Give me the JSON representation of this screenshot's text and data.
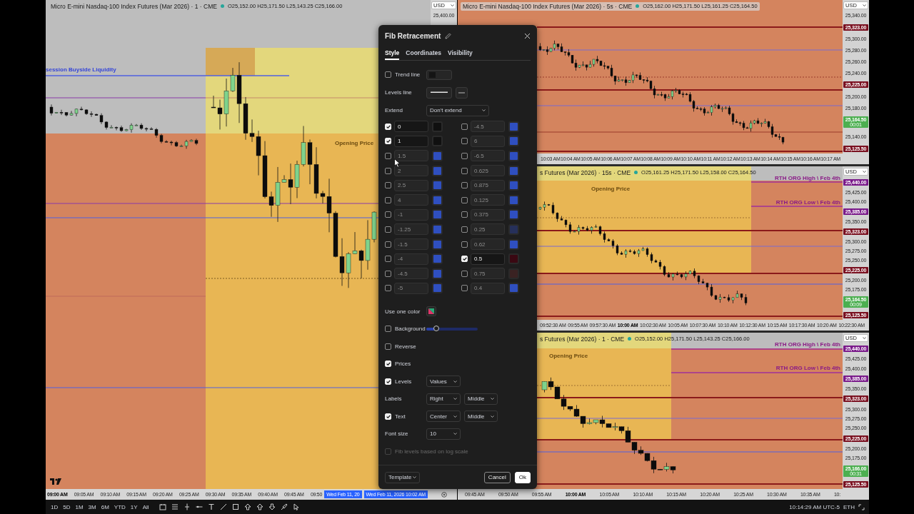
{
  "charts": [
    {
      "title": "Micro E-mini Nasdaq-100 Index Futures (Mar 2026) · 1 · CME",
      "ohlc": "O25,152.00 H25,171.50 L25,143.25 C25,166.00",
      "currency": "USD",
      "price_labels": [
        {
          "text": "25,400.00",
          "kind": "plain"
        }
      ],
      "line_labels": [
        {
          "text": "session Buyside Liquidity",
          "color": "#3545d8"
        },
        {
          "text": "Opening Price",
          "color": "#6a4a10"
        }
      ],
      "time_labels": [
        {
          "text": "09:00 AM",
          "major": true
        },
        {
          "text": "09:05 AM",
          "major": false
        },
        {
          "text": "09:10 AM",
          "major": false
        },
        {
          "text": "09:15 AM",
          "major": false
        },
        {
          "text": "09:20 AM",
          "major": false
        },
        {
          "text": "09:25 AM",
          "major": false
        },
        {
          "text": "09:30 AM",
          "major": false
        },
        {
          "text": "09:35 AM",
          "major": false
        },
        {
          "text": "09:40 AM",
          "major": false
        },
        {
          "text": "09:45 AM",
          "major": false
        },
        {
          "text": "09:50",
          "major": false
        }
      ],
      "date_tags": [
        "Wed Feb 11, 20",
        "Wed Feb 11, 2026 10:02 AM"
      ]
    },
    {
      "title": "Micro E-mini Nasdaq-100 Index Futures (Mar 2026) · 5s · CME",
      "ohlc": "O25,162.00 H25,171.50 L25,161.25 C25,164.50",
      "currency": "USD",
      "price_labels": [
        {
          "text": "25,340.00",
          "kind": "plain"
        },
        {
          "text": "25,323.00",
          "kind": "marker",
          "color": "#7a1020"
        },
        {
          "text": "25,300.00",
          "kind": "plain"
        },
        {
          "text": "25,280.00",
          "kind": "plain"
        },
        {
          "text": "25,260.00",
          "kind": "plain"
        },
        {
          "text": "25,240.00",
          "kind": "plain"
        },
        {
          "text": "25,225.00",
          "kind": "marker",
          "color": "#7a1020"
        },
        {
          "text": "25,200.00",
          "kind": "plain"
        },
        {
          "text": "25,180.00",
          "kind": "plain"
        },
        {
          "text": "25,164.50",
          "kind": "marker",
          "color": "#4caf50",
          "countdown": "00:01"
        },
        {
          "text": "25,140.00",
          "kind": "plain"
        },
        {
          "text": "25,125.50",
          "kind": "marker",
          "color": "#7a1020"
        }
      ],
      "time_labels": [
        {
          "text": "10:03 AM",
          "major": false
        },
        {
          "text": "10:04 AM",
          "major": false
        },
        {
          "text": "10:05 AM",
          "major": false
        },
        {
          "text": "10:06 AM",
          "major": false
        },
        {
          "text": "10:07 AM",
          "major": false
        },
        {
          "text": "10:08 AM",
          "major": false
        },
        {
          "text": "10:09 AM",
          "major": false
        },
        {
          "text": "10:10 AM",
          "major": false
        },
        {
          "text": "10:11 AM",
          "major": false
        },
        {
          "text": "10:12 AM",
          "major": false
        },
        {
          "text": "10:13 AM",
          "major": false
        },
        {
          "text": "10:14 AM",
          "major": false
        },
        {
          "text": "10:15 AM",
          "major": false
        },
        {
          "text": "10:16 AM",
          "major": false
        },
        {
          "text": "10:17 AM",
          "major": false
        }
      ]
    },
    {
      "title": "s Futures (Mar 2026) · 15s · CME",
      "ohlc": "O25,161.25 H25,171.50 L25,158.00 C25,164.50",
      "currency": "USD",
      "price_labels": [
        {
          "text": "25,440.00",
          "kind": "marker",
          "color": "#7a1a8a"
        },
        {
          "text": "25,425.00",
          "kind": "plain"
        },
        {
          "text": "25,400.00",
          "kind": "plain"
        },
        {
          "text": "25,385.00",
          "kind": "marker",
          "color": "#7a1a8a"
        },
        {
          "text": "25,350.00",
          "kind": "plain"
        },
        {
          "text": "25,323.00",
          "kind": "marker",
          "color": "#7a1020"
        },
        {
          "text": "25,300.00",
          "kind": "plain"
        },
        {
          "text": "25,275.00",
          "kind": "plain"
        },
        {
          "text": "25,250.00",
          "kind": "plain"
        },
        {
          "text": "25,225.00",
          "kind": "marker",
          "color": "#7a1020"
        },
        {
          "text": "25,200.00",
          "kind": "plain"
        },
        {
          "text": "25,175.00",
          "kind": "plain"
        },
        {
          "text": "25,164.50",
          "kind": "marker",
          "color": "#4caf50",
          "countdown": "00:09"
        },
        {
          "text": "25,125.50",
          "kind": "marker",
          "color": "#7a1020"
        }
      ],
      "line_labels": [
        {
          "text": "RTH ORG High \\ Feb 4th",
          "color": "#8a1a86"
        },
        {
          "text": "RTH ORG Low \\ Feb 4th",
          "color": "#8a1a86"
        },
        {
          "text": "Opening Price",
          "color": "#6a4a10"
        }
      ],
      "time_labels": [
        {
          "text": "09:52:30 AM",
          "major": false
        },
        {
          "text": "09:55 AM",
          "major": false
        },
        {
          "text": "09:57:30 AM",
          "major": false
        },
        {
          "text": "10:00 AM",
          "major": true
        },
        {
          "text": "10:02:30 AM",
          "major": false
        },
        {
          "text": "10:05 AM",
          "major": false
        },
        {
          "text": "10:07:30 AM",
          "major": false
        },
        {
          "text": "10:10 AM",
          "major": false
        },
        {
          "text": "10:12:30 AM",
          "major": false
        },
        {
          "text": "10:15 AM",
          "major": false
        },
        {
          "text": "10:17:30 AM",
          "major": false
        },
        {
          "text": "10:20 AM",
          "major": false
        },
        {
          "text": "10:22:30 AM",
          "major": false
        }
      ]
    },
    {
      "title": "s Futures (Mar 2026) · 1 · CME",
      "ohlc": "O25,152.00 H25,171.50 L25,143.25 C25,166.00",
      "currency": "USD",
      "price_labels": [
        {
          "text": "25,440.00",
          "kind": "marker",
          "color": "#7a1a8a"
        },
        {
          "text": "25,425.00",
          "kind": "plain"
        },
        {
          "text": "25,400.00",
          "kind": "plain"
        },
        {
          "text": "25,385.00",
          "kind": "marker",
          "color": "#7a1a8a"
        },
        {
          "text": "25,350.00",
          "kind": "plain"
        },
        {
          "text": "25,323.00",
          "kind": "marker",
          "color": "#7a1020"
        },
        {
          "text": "25,300.00",
          "kind": "plain"
        },
        {
          "text": "25,275.00",
          "kind": "plain"
        },
        {
          "text": "25,250.00",
          "kind": "plain"
        },
        {
          "text": "25,225.00",
          "kind": "marker",
          "color": "#7a1020"
        },
        {
          "text": "25,200.00",
          "kind": "plain"
        },
        {
          "text": "25,175.00",
          "kind": "plain"
        },
        {
          "text": "25,166.00",
          "kind": "marker",
          "color": "#4caf50",
          "countdown": "00:31"
        },
        {
          "text": "25,125.50",
          "kind": "marker",
          "color": "#7a1020"
        }
      ],
      "line_labels": [
        {
          "text": "RTH ORG High \\ Feb 4th",
          "color": "#8a1a86"
        },
        {
          "text": "RTH ORG Low \\ Feb 4th",
          "color": "#8a1a86"
        },
        {
          "text": "Opening Price",
          "color": "#6a4a10"
        }
      ],
      "time_labels": [
        {
          "text": "09:45 AM",
          "major": false
        },
        {
          "text": "09:50 AM",
          "major": false
        },
        {
          "text": "09:55 AM",
          "major": false
        },
        {
          "text": "10:00 AM",
          "major": true
        },
        {
          "text": "10:05 AM",
          "major": false
        },
        {
          "text": "10:10 AM",
          "major": false
        },
        {
          "text": "10:15 AM",
          "major": false
        },
        {
          "text": "10:20 AM",
          "major": false
        },
        {
          "text": "10:25 AM",
          "major": false
        },
        {
          "text": "10:30 AM",
          "major": false
        },
        {
          "text": "10:35 AM",
          "major": false
        },
        {
          "text": "10:",
          "major": false
        }
      ]
    }
  ],
  "dialog": {
    "title": "Fib Retracement",
    "tabs": [
      {
        "label": "Style",
        "selected": true
      },
      {
        "label": "Coordinates",
        "selected": false
      },
      {
        "label": "Visibility",
        "selected": false
      }
    ],
    "trend_line": {
      "label": "Trend line",
      "checked": false
    },
    "levels_line": {
      "label": "Levels line"
    },
    "extend": {
      "label": "Extend",
      "value": "Don't extend"
    },
    "level_columns": [
      {
        "levels": [
          {
            "value": "0",
            "checked": true,
            "color": "#101010"
          },
          {
            "value": "1",
            "checked": true,
            "color": "#101010"
          },
          {
            "value": "1.5",
            "checked": false,
            "color": "#2f4fc0"
          },
          {
            "value": "2",
            "checked": false,
            "color": "#2f4fc0"
          },
          {
            "value": "2.5",
            "checked": false,
            "color": "#2f4fc0"
          },
          {
            "value": "4",
            "checked": false,
            "color": "#2f4fc0"
          },
          {
            "value": "-1",
            "checked": false,
            "color": "#2f4fc0"
          },
          {
            "value": "-1.25",
            "checked": false,
            "color": "#2f4fc0"
          },
          {
            "value": "-1.5",
            "checked": false,
            "color": "#2f4fc0"
          },
          {
            "value": "-4",
            "checked": false,
            "color": "#2f4fc0"
          },
          {
            "value": "-4.5",
            "checked": false,
            "color": "#2f4fc0"
          },
          {
            "value": "-5",
            "checked": false,
            "color": "#2f4fc0"
          }
        ]
      },
      {
        "levels": [
          {
            "value": "-4.5",
            "checked": false,
            "color": "#2f4fc0"
          },
          {
            "value": "6",
            "checked": false,
            "color": "#2f4fc0"
          },
          {
            "value": "-6.5",
            "checked": false,
            "color": "#2f4fc0"
          },
          {
            "value": "0.625",
            "checked": false,
            "color": "#2f4fc0"
          },
          {
            "value": "0.875",
            "checked": false,
            "color": "#2f4fc0"
          },
          {
            "value": "0.125",
            "checked": false,
            "color": "#2f4fc0"
          },
          {
            "value": "0.375",
            "checked": false,
            "color": "#2f4fc0"
          },
          {
            "value": "0.25",
            "checked": false,
            "color": "#26305a"
          },
          {
            "value": "0.62",
            "checked": false,
            "color": "#2f4fc0"
          },
          {
            "value": "0.5",
            "checked": true,
            "color": "#3a0812"
          },
          {
            "value": "0.75",
            "checked": false,
            "color": "#3a2222"
          },
          {
            "value": "0.4",
            "checked": false,
            "color": "#2f4fc0"
          }
        ]
      }
    ],
    "options": [
      {
        "kind": "color",
        "label": "Use one color",
        "disabled": false
      },
      {
        "kind": "slider",
        "label": "Background",
        "checked": false,
        "level": 0.2,
        "disabled": false
      },
      {
        "kind": "check",
        "label": "Reverse",
        "checked": false,
        "disabled": false
      },
      {
        "kind": "check",
        "label": "Prices",
        "checked": true,
        "disabled": false
      },
      {
        "kind": "check",
        "label": "Levels",
        "checked": true,
        "selects": [
          "Values"
        ],
        "disabled": false
      },
      {
        "kind": "select",
        "label": "Labels",
        "selects": [
          "Right",
          "Middle"
        ],
        "disabled": false
      },
      {
        "kind": "check",
        "label": "Text",
        "checked": true,
        "selects": [
          "Center",
          "Middle"
        ],
        "disabled": false
      },
      {
        "kind": "select",
        "label": "Font size",
        "selects": [
          "10"
        ],
        "disabled": false
      },
      {
        "kind": "check",
        "label": "Fib levels based on log scale",
        "checked": false,
        "disabled": true
      }
    ],
    "template": "Template",
    "cancel": "Cancel",
    "ok": "Ok"
  },
  "toolbar": {
    "intervals": [
      "1D",
      "5D",
      "1M",
      "3M",
      "6M",
      "YTD",
      "1Y",
      "All"
    ],
    "clock": "10:14:29 AM UTC-5",
    "session": "ETH"
  }
}
